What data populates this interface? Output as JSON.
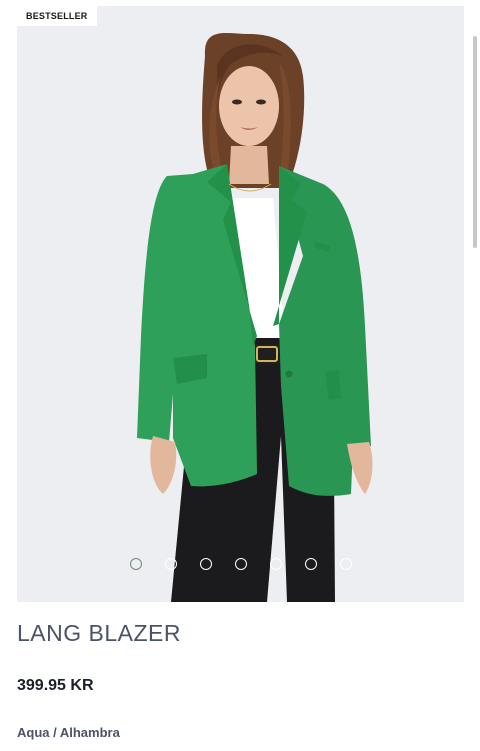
{
  "product": {
    "badge": "BESTSELLER",
    "name": "LANG BLAZER",
    "price": "399.95 KR",
    "color": "Aqua / Alhambra"
  },
  "gallery": {
    "image_alt": "Model wearing a green blazer, white top and black trousers",
    "slide_count": 7,
    "active_slide": 1
  },
  "colors": {
    "blazer": "#2ea05a",
    "background": "#eceef1",
    "title": "#4a5466",
    "price": "#1b1f2b"
  }
}
